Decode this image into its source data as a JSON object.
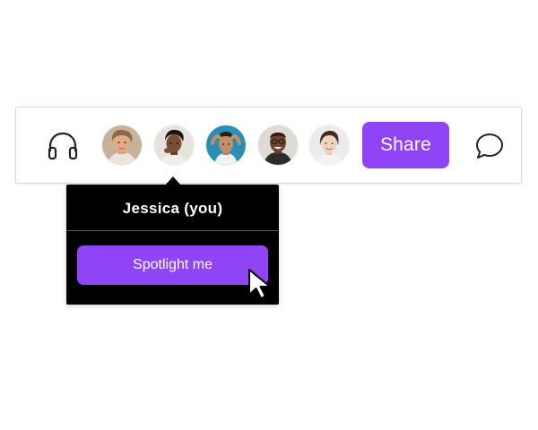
{
  "toolbar": {
    "share_label": "Share",
    "icons": {
      "audio": "headphones-icon",
      "chat": "comment-icon"
    },
    "participants": [
      {
        "id": "participant-1",
        "bg": "#c9b29a"
      },
      {
        "id": "participant-2",
        "bg": "#e8e2dc"
      },
      {
        "id": "participant-3",
        "bg": "#2a8fb5"
      },
      {
        "id": "participant-4",
        "bg": "#dedbd6"
      },
      {
        "id": "participant-5",
        "bg": "#ebebeb"
      }
    ]
  },
  "popover": {
    "title": "Jessica (you)",
    "action_label": "Spotlight me"
  },
  "colors": {
    "accent": "#8f44f5",
    "popover_bg": "#000000",
    "toolbar_border": "#d9d9d9"
  },
  "cursor": "arrow-cursor-icon"
}
